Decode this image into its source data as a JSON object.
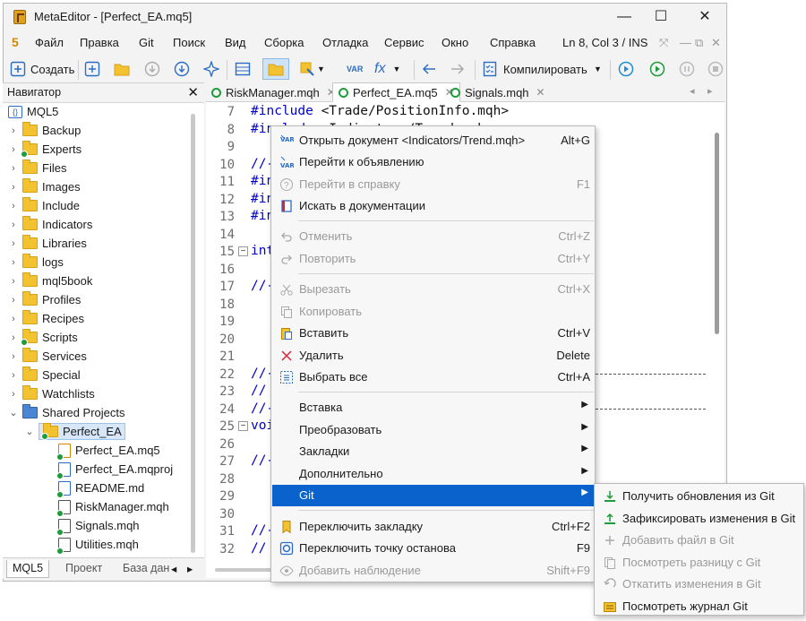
{
  "window": {
    "title": "MetaEditor - [Perfect_EA.mq5]"
  },
  "window_controls": {
    "minimize": "—",
    "maximize": "☐",
    "close": "✕"
  },
  "menubar": {
    "logo": "5",
    "items": [
      "Файл",
      "Правка",
      "Git",
      "Поиск",
      "Вид",
      "Сборка",
      "Отладка",
      "Сервис",
      "Окно",
      "Справка"
    ],
    "status": "Ln 8, Col 3 / INS",
    "mdi_controls": [
      "⤧",
      "—",
      "⧉",
      "✕"
    ]
  },
  "toolbar": {
    "create_label": "Создать",
    "compile_label": "Компилировать",
    "var_label": "VAR",
    "fx_label": "fx"
  },
  "navigator": {
    "title": "Навигатор",
    "close": "✕",
    "root": "MQL5",
    "folders": [
      "Backup",
      "Experts",
      "Files",
      "Images",
      "Include",
      "Indicators",
      "Libraries",
      "logs",
      "mql5book",
      "Profiles",
      "Recipes",
      "Scripts",
      "Services",
      "Special",
      "Watchlists",
      "Shared Projects"
    ],
    "project": "Perfect_EA",
    "files": [
      "Perfect_EA.mq5",
      "Perfect_EA.mqproj",
      "README.md",
      "RiskManager.mqh",
      "Signals.mqh",
      "Utilities.mqh"
    ],
    "tabs": [
      "MQL5",
      "Проект",
      "База дан"
    ],
    "tab_arrows": [
      "◂",
      "▸"
    ]
  },
  "editor": {
    "tabs": [
      {
        "label": "RiskManager.mqh",
        "close": "✕"
      },
      {
        "label": "Perfect_EA.mq5",
        "close": "✕"
      },
      {
        "label": "Signals.mqh",
        "close": "✕"
      }
    ],
    "tab_nav": [
      "◂",
      "▸"
    ],
    "lines": [
      {
        "n": "7",
        "kw": "#include",
        "rest": " <Trade/PositionInfo.mqh>"
      },
      {
        "n": "8",
        "kw": "#include",
        "rest": " <Indicators/Trend.mqh>"
      },
      {
        "n": "9",
        "kw": "",
        "rest": ""
      },
      {
        "n": "10",
        "kw": "//-",
        "rest": ""
      },
      {
        "n": "11",
        "kw": "#in",
        "rest": ""
      },
      {
        "n": "12",
        "kw": "#in",
        "rest": ""
      },
      {
        "n": "13",
        "kw": "#in",
        "rest": ""
      },
      {
        "n": "14",
        "kw": "",
        "rest": ""
      },
      {
        "n": "15",
        "kw": "int",
        "rest": ""
      },
      {
        "n": "16",
        "kw": "",
        "rest": ""
      },
      {
        "n": "17",
        "kw": "//-",
        "rest": ""
      },
      {
        "n": "18",
        "kw": "",
        "rest": ""
      },
      {
        "n": "19",
        "kw": "",
        "rest": ""
      },
      {
        "n": "20",
        "kw": "",
        "rest": ""
      },
      {
        "n": "21",
        "kw": "",
        "rest": ""
      },
      {
        "n": "22",
        "kw": "//-",
        "rest": ""
      },
      {
        "n": "23",
        "kw": "//",
        "rest": ""
      },
      {
        "n": "24",
        "kw": "//-",
        "rest": ""
      },
      {
        "n": "25",
        "kw": "voi",
        "rest": ""
      },
      {
        "n": "26",
        "kw": "",
        "rest": ""
      },
      {
        "n": "27",
        "kw": "//-",
        "rest": ""
      },
      {
        "n": "28",
        "kw": "",
        "rest": ""
      },
      {
        "n": "29",
        "kw": "",
        "rest": ""
      },
      {
        "n": "30",
        "kw": "",
        "rest": ""
      },
      {
        "n": "31",
        "kw": "//-",
        "rest": ""
      },
      {
        "n": "32",
        "kw": "//",
        "rest": ""
      }
    ]
  },
  "context_menu": {
    "items": [
      {
        "label": "Открыть документ <Indicators/Trend.mqh>",
        "shortcut": "Alt+G",
        "icon": "var-goto-icon",
        "disabled": false
      },
      {
        "label": "Перейти к объявлению",
        "shortcut": "",
        "icon": "var-decl-icon",
        "disabled": false
      },
      {
        "label": "Перейти в справку",
        "shortcut": "F1",
        "icon": "help-icon",
        "disabled": true
      },
      {
        "label": "Искать в документации",
        "shortcut": "",
        "icon": "book-icon",
        "disabled": false
      },
      {
        "label": "Отменить",
        "shortcut": "Ctrl+Z",
        "icon": "undo-icon",
        "disabled": true
      },
      {
        "label": "Повторить",
        "shortcut": "Ctrl+Y",
        "icon": "redo-icon",
        "disabled": true
      },
      {
        "label": "Вырезать",
        "shortcut": "Ctrl+X",
        "icon": "cut-icon",
        "disabled": true
      },
      {
        "label": "Копировать",
        "shortcut": "",
        "icon": "copy-icon",
        "disabled": true
      },
      {
        "label": "Вставить",
        "shortcut": "Ctrl+V",
        "icon": "paste-icon",
        "disabled": false
      },
      {
        "label": "Удалить",
        "shortcut": "Delete",
        "icon": "delete-icon",
        "disabled": false
      },
      {
        "label": "Выбрать все",
        "shortcut": "Ctrl+A",
        "icon": "select-all-icon",
        "disabled": false
      },
      {
        "label": "Вставка",
        "shortcut": "",
        "icon": "",
        "disabled": false,
        "submenu": true
      },
      {
        "label": "Преобразовать",
        "shortcut": "",
        "icon": "",
        "disabled": false,
        "submenu": true
      },
      {
        "label": "Закладки",
        "shortcut": "",
        "icon": "",
        "disabled": false,
        "submenu": true
      },
      {
        "label": "Дополнительно",
        "shortcut": "",
        "icon": "",
        "disabled": false,
        "submenu": true
      },
      {
        "label": "Git",
        "shortcut": "",
        "icon": "",
        "disabled": false,
        "submenu": true,
        "highlighted": true
      },
      {
        "label": "Переключить закладку",
        "shortcut": "Ctrl+F2",
        "icon": "bookmark-icon",
        "disabled": false
      },
      {
        "label": "Переключить точку останова",
        "shortcut": "F9",
        "icon": "breakpoint-icon",
        "disabled": false
      },
      {
        "label": "Добавить наблюдение",
        "shortcut": "Shift+F9",
        "icon": "watch-icon",
        "disabled": true
      }
    ],
    "submenu_arrow": "▶"
  },
  "git_submenu": {
    "items": [
      {
        "label": "Получить обновления из Git",
        "icon": "git-pull-icon",
        "disabled": false
      },
      {
        "label": "Зафиксировать изменения в Git",
        "icon": "git-commit-icon",
        "disabled": false
      },
      {
        "label": "Добавить файл в Git",
        "icon": "git-add-icon",
        "disabled": true
      },
      {
        "label": "Посмотреть разницу с Git",
        "icon": "git-diff-icon",
        "disabled": true
      },
      {
        "label": "Откатить изменения в Git",
        "icon": "git-revert-icon",
        "disabled": true
      },
      {
        "label": "Посмотреть журнал Git",
        "icon": "git-log-icon",
        "disabled": false
      }
    ]
  },
  "colors": {
    "accent": "#0a63cc",
    "keyword": "#0000c8",
    "folder": "#f2c230",
    "git_green": "#1e9b3a"
  }
}
